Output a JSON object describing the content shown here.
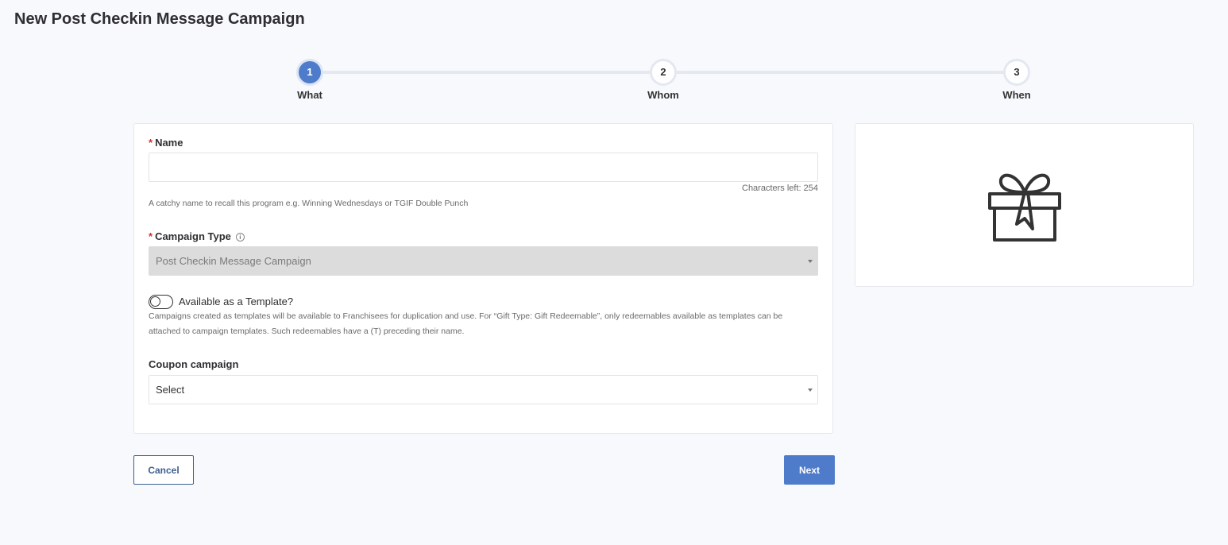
{
  "page": {
    "title": "New Post Checkin Message Campaign"
  },
  "stepper": {
    "steps": [
      {
        "number": "1",
        "label": "What"
      },
      {
        "number": "2",
        "label": "Whom"
      },
      {
        "number": "3",
        "label": "When"
      }
    ],
    "active_step": 1
  },
  "form": {
    "required_marker": "*",
    "name": {
      "label": "Name",
      "value": "",
      "placeholder": "",
      "counter": "Characters left: 254",
      "hint": "A catchy name to recall this program e.g. Winning Wednesdays or TGIF Double Punch"
    },
    "campaign_type": {
      "label": "Campaign Type",
      "info_icon": "i",
      "value": "Post Checkin Message Campaign",
      "disabled": true
    },
    "template_toggle": {
      "label": "Available as a Template?",
      "on": false,
      "hint": "Campaigns created as templates will be available to Franchisees for duplication and use. For “Gift Type: Gift Redeemable”, only redeemables available as templates can be attached to campaign templates. Such redeemables have a (T) preceding their name."
    },
    "coupon_campaign": {
      "label": "Coupon campaign",
      "value": "Select"
    }
  },
  "preview": {
    "icon": "gift-icon"
  },
  "actions": {
    "cancel_label": "Cancel",
    "next_label": "Next"
  },
  "colors": {
    "primary": "#4f7cca",
    "outline": "#3d5f8f",
    "required": "#d0312d"
  }
}
